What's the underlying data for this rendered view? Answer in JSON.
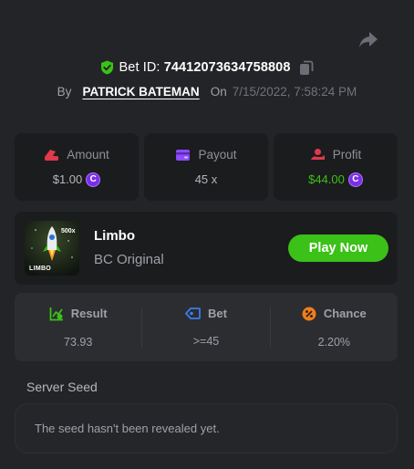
{
  "header": {
    "bet_id_label": "Bet ID:",
    "bet_id": "74412073634758808",
    "by_label": "By",
    "user_name": "PATRICK BATEMAN",
    "on_label": "On",
    "timestamp": "7/15/2022, 7:58:24 PM"
  },
  "stats": [
    {
      "label": "Amount",
      "value": "$1.00",
      "icon": "amount-icon",
      "coin": "C"
    },
    {
      "label": "Payout",
      "value": "45 x",
      "icon": "wallet-icon"
    },
    {
      "label": "Profit",
      "value": "$44.00",
      "icon": "profit-icon",
      "coin": "C"
    }
  ],
  "game": {
    "name": "Limbo",
    "provider": "BC Original",
    "thumb_label": "LIMBO",
    "thumb_badge": "500x",
    "play_label": "Play Now"
  },
  "result": [
    {
      "label": "Result",
      "value": "73.93",
      "icon": "chart-check-icon"
    },
    {
      "label": "Bet",
      "value": ">=45",
      "icon": "tag-icon"
    },
    {
      "label": "Chance",
      "value": "2.20%",
      "icon": "percent-icon"
    }
  ],
  "seed": {
    "label": "Server Seed",
    "message": "The seed hasn't been revealed yet."
  },
  "colors": {
    "background": "#232427",
    "card": "#1b1c1e",
    "accent_green": "#3bc117",
    "coin_purple": "#7b2ee8"
  }
}
